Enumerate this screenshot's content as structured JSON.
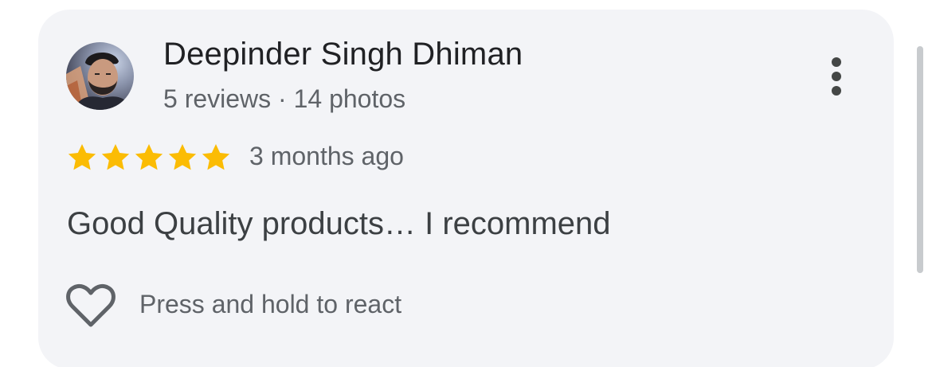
{
  "review": {
    "author_name": "Deepinder Singh Dhiman",
    "author_meta": "5 reviews · 14 photos",
    "rating": 5,
    "rating_max": 5,
    "date": "3 months ago",
    "text": "Good Quality products… I recommend",
    "react_label": "Press and hold to react"
  },
  "colors": {
    "card_background": "#f3f4f7",
    "star": "#fbbc04",
    "primary_text": "#202124",
    "secondary_text": "#5f6368"
  },
  "icons": {
    "more": "more-vert-icon",
    "heart": "heart-outline-icon",
    "star": "star-icon"
  }
}
